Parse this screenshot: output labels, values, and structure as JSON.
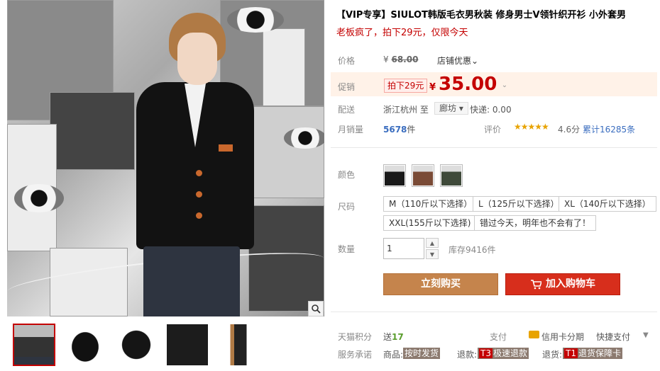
{
  "product": {
    "title": "【VIP专享】SIULOT韩版毛衣男秋装 修身男士V领针织开衫 小外套男",
    "subtitle": "老板疯了，拍下29元，仅限今天"
  },
  "gallery": {
    "thumbnails": [
      "thumb-1",
      "thumb-2",
      "thumb-3",
      "thumb-4",
      "thumb-5"
    ],
    "zoom_icon": "magnifier-icon"
  },
  "price": {
    "label": "价格",
    "currency": "¥",
    "original": "68.00",
    "shop_discount": "店铺优惠",
    "shop_discount_arrow": "⌄"
  },
  "promo": {
    "label": "促销",
    "tag": "拍下29元",
    "currency": "¥",
    "price": "35.00",
    "arrow": "⌄"
  },
  "delivery": {
    "label": "配送",
    "from": "浙江杭州 至",
    "to": "廊坊",
    "to_arrow": "▾",
    "fee": "快递: 0.00"
  },
  "sales": {
    "label": "月销量",
    "count": "5678",
    "unit": "件",
    "rating_label": "评价",
    "stars": "★★★★★",
    "rating": "4.6分",
    "reviews": "累计16285条"
  },
  "colors": {
    "label": "颜色",
    "options": [
      "#1a1a1a",
      "#7a4b36",
      "#3f4a3a"
    ]
  },
  "sizes": {
    "label": "尺码",
    "options": [
      "M（110斤以下选择）",
      "L（125斤以下选择）",
      "XL（140斤以下选择）",
      "XXL(155斤以下选择)",
      "错过今天，明年也不会有了！"
    ]
  },
  "quantity": {
    "label": "数量",
    "value": "1",
    "up": "▲",
    "down": "▼",
    "stock": "库存9416件"
  },
  "actions": {
    "buy_now": "立刻购买",
    "add_to_cart": "加入购物车"
  },
  "points": {
    "label": "天猫积分",
    "prefix": "送",
    "value": "17",
    "pay_label": "支付",
    "card": "信用卡分期",
    "express": "快捷支付",
    "express_arrow": "▼"
  },
  "service": {
    "label": "服务承诺",
    "goods_label": "商品:",
    "goods_badge": "按时发货",
    "refund_label": "退款:",
    "refund_code": "T3",
    "refund_badge": "极速退款",
    "return_label": "退货:",
    "return_code": "T1",
    "return_badge": "退货保障卡"
  },
  "colors_theme": {
    "accent_red": "#c40000",
    "buy_button": "#c5844c",
    "cart_button": "#d72e1c",
    "link_blue": "#3a6dbf",
    "star_gold": "#e8a300"
  }
}
